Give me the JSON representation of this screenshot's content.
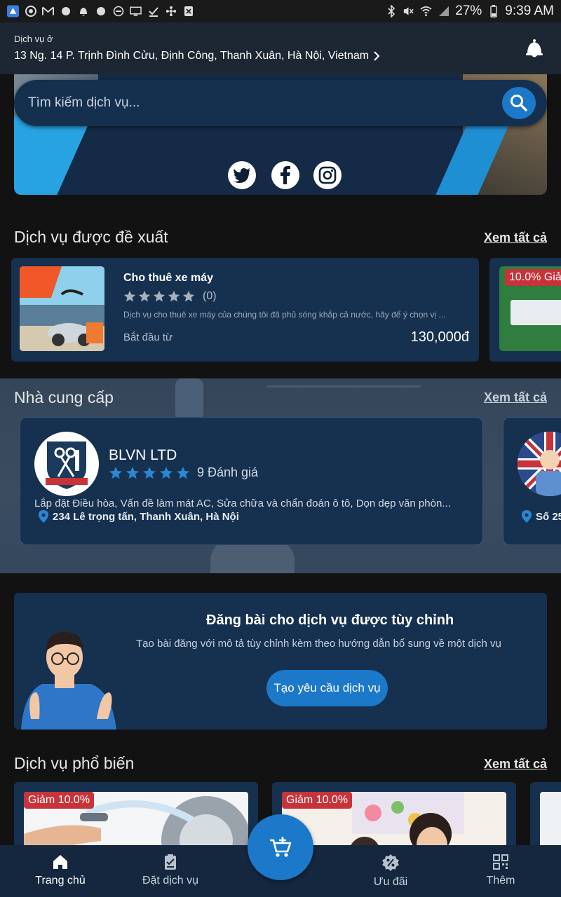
{
  "status_bar": {
    "battery": "27%",
    "time": "9:39 AM"
  },
  "header": {
    "location_label": "Dịch vụ ở",
    "address": "13 Ng. 14 P. Trịnh Đình Cửu, Định Công, Thanh Xuân, Hà Nội, Vietnam"
  },
  "search": {
    "placeholder": "Tìm kiếm dịch vụ..."
  },
  "recommended": {
    "title": "Dịch vụ được đề xuất",
    "see_all": "Xem tất cả",
    "items": [
      {
        "title": "Cho thuê xe máy",
        "rating_count": "(0)",
        "description": "Dịch vụ cho thuê xe máy của chúng tôi đã phủ sóng khắp cả nước, hãy để ý chọn vị ...",
        "price_prefix": "Bắt đầu từ",
        "price": "130,000đ"
      },
      {
        "discount": "10.0% Giả"
      }
    ]
  },
  "providers": {
    "title": "Nhà cung cấp",
    "see_all": "Xem tất cả",
    "items": [
      {
        "name": "BLVN LTD",
        "reviews": "9 Đánh giá",
        "services": "Lắp đặt Điều hòa, Vấn đề làm mát AC, Sửa chữa và chẩn đoán ô tô, Dọn dẹp văn phòn...",
        "address": "234 Lê trọng tấn, Thanh Xuân, Hà Nội"
      },
      {
        "address": "Số 25"
      }
    ]
  },
  "custom_post": {
    "title": "Đăng bài cho dịch vụ được tùy chỉnh",
    "description": "Tạo bài đăng với mô tả tùy chỉnh kèm theo hướng dẫn bổ sung về một dịch vụ",
    "button": "Tạo yêu cầu dịch vụ"
  },
  "popular": {
    "title": "Dịch vụ phổ biến",
    "see_all": "Xem tất cả",
    "items": [
      {
        "discount": "Giảm 10.0%"
      },
      {
        "discount": "Giảm 10.0%"
      }
    ]
  },
  "bottom_nav": {
    "items": [
      {
        "label": "Trang chủ",
        "active": true
      },
      {
        "label": "Đặt dịch vụ",
        "active": false
      },
      {
        "label": "Ưu đãi",
        "active": false
      },
      {
        "label": "Thêm",
        "active": false
      }
    ]
  },
  "colors": {
    "accent": "#1c78c8",
    "card": "#16304f",
    "background": "#121212",
    "discount": "#c7333a",
    "star_gray": "#a7b1bc",
    "star_blue": "#2a87d6"
  },
  "icons": [
    "bell-icon",
    "search-icon",
    "twitter-icon",
    "facebook-icon",
    "instagram-icon",
    "star-icon",
    "location-pin-icon",
    "home-icon",
    "clipboard-icon",
    "cart-plus-icon",
    "discount-badge-icon",
    "grid-icon"
  ]
}
